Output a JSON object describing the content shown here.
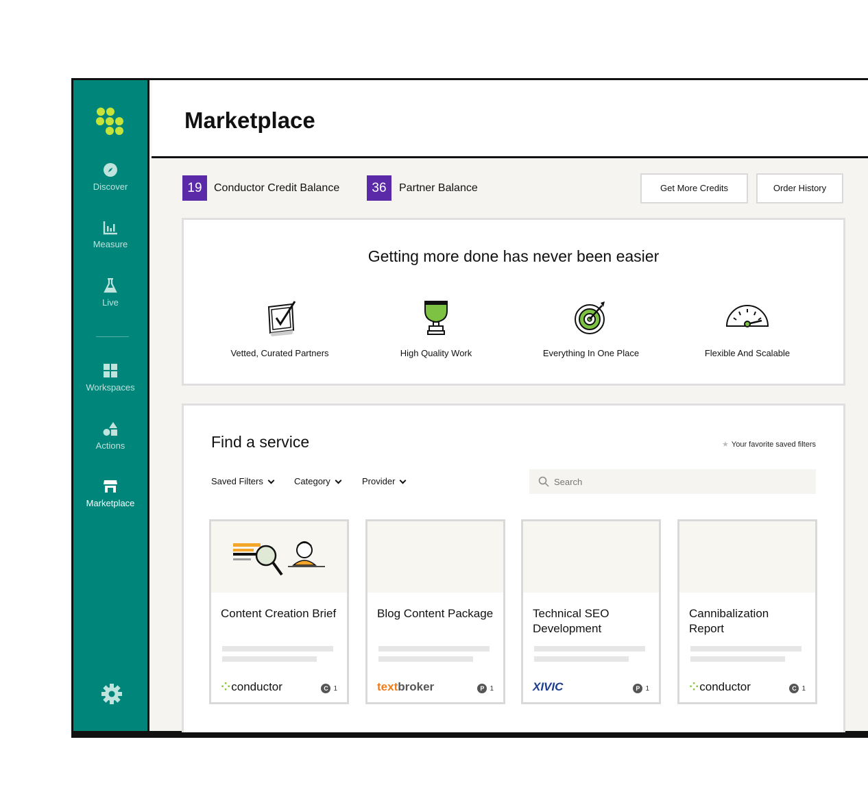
{
  "sidebar": {
    "items": [
      {
        "label": "Discover",
        "icon": "compass-icon"
      },
      {
        "label": "Measure",
        "icon": "bar-chart-icon"
      },
      {
        "label": "Live",
        "icon": "flask-icon"
      },
      {
        "label": "Workspaces",
        "icon": "grid-icon"
      },
      {
        "label": "Actions",
        "icon": "shapes-icon"
      },
      {
        "label": "Marketplace",
        "icon": "store-icon"
      }
    ],
    "active": "Marketplace",
    "settings_icon": "gear-icon"
  },
  "header": {
    "title": "Marketplace"
  },
  "balances": {
    "conductor_value": "19",
    "conductor_label": "Conductor Credit Balance",
    "partner_value": "36",
    "partner_label": "Partner Balance"
  },
  "actions": {
    "get_more_credits": "Get More Credits",
    "order_history": "Order History"
  },
  "hero": {
    "title": "Getting more done has never been easier",
    "features": [
      {
        "label": "Vetted, Curated Partners",
        "icon": "checkbox-icon"
      },
      {
        "label": "High Quality Work",
        "icon": "trophy-icon"
      },
      {
        "label": "Everything In One Place",
        "icon": "target-icon"
      },
      {
        "label": "Flexible And Scalable",
        "icon": "gauge-icon"
      }
    ]
  },
  "service": {
    "title": "Find a service",
    "favorite_filters": "Your favorite saved filters",
    "filters": [
      "Saved Filters",
      "Category",
      "Provider"
    ],
    "search_placeholder": "Search",
    "cards": [
      {
        "title": "Content Creation Brief",
        "provider": "conductor",
        "credit_type": "C",
        "credit_count": "1"
      },
      {
        "title": "Blog Content Package",
        "provider_a": "text",
        "provider_b": "broker",
        "credit_type": "P",
        "credit_count": "1"
      },
      {
        "title": "Technical SEO Development",
        "provider": "XIVIC",
        "credit_type": "P",
        "credit_count": "1"
      },
      {
        "title": "Cannibalization Report",
        "provider": "conductor",
        "credit_type": "C",
        "credit_count": "1"
      }
    ]
  },
  "colors": {
    "sidebar": "#00857a",
    "badge": "#5b2aa8",
    "accent_green": "#8dc63f",
    "textbroker_orange": "#f07d1a"
  }
}
